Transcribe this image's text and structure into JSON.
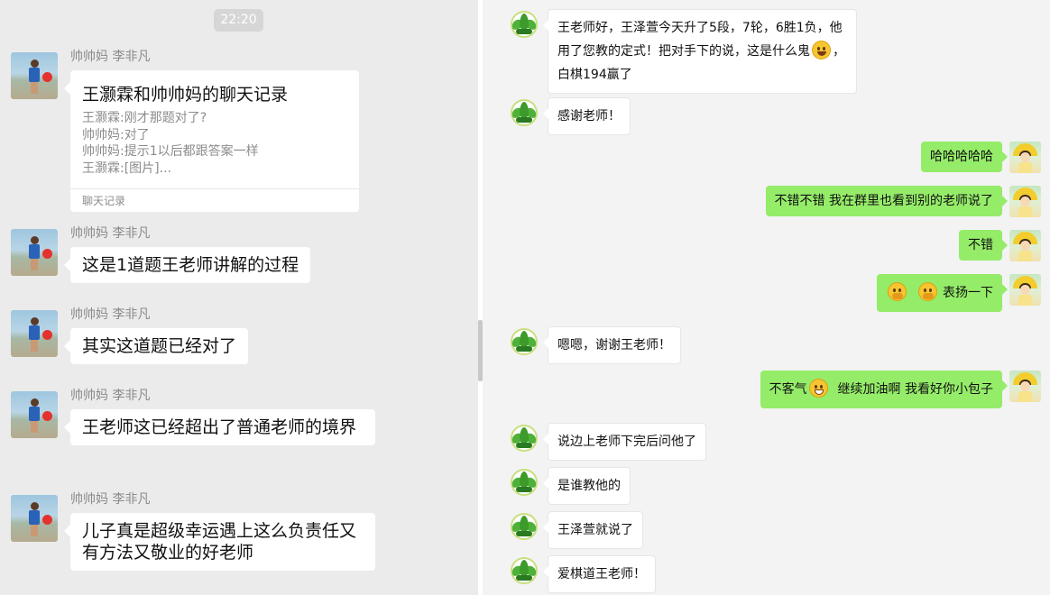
{
  "left": {
    "time": "22:20",
    "record": {
      "sender": "帅帅妈 李非凡",
      "title": "王灏霖和帅帅妈的聊天记录",
      "lines": [
        "王灏霖:刚才那题对了?",
        "帅帅妈:对了",
        "帅帅妈:提示1以后都跟答案一样",
        "王灏霖:[图片]..."
      ],
      "footer": "聊天记录"
    },
    "messages": [
      {
        "sender": "帅帅妈 李非凡",
        "text": "这是1道题王老师讲解的过程"
      },
      {
        "sender": "帅帅妈 李非凡",
        "text": "其实这道题已经对了"
      },
      {
        "sender": "帅帅妈 李非凡",
        "text": "王老师这已经超出了普通老师的境界"
      },
      {
        "sender": "帅帅妈 李非凡",
        "text": "儿子真是超级幸运遇上这么负责任又有方法又敬业的好老师"
      }
    ]
  },
  "right": {
    "msg1": {
      "a": "王老师好，王泽萱今天升了5段，7轮，6胜1负，他用了您教的定式！把对手下的说，这是什么鬼",
      "b": "，白棋194赢了",
      "emoji": "smile-emoji"
    },
    "msg2": "感谢老师！",
    "msg3": "哈哈哈哈哈",
    "msg4": "不错不错 我在群里也看到别的老师说了",
    "msg5": "不错",
    "msg6": {
      "text": "表扬一下",
      "emoji": "cover-mouth-emoji"
    },
    "msg7": "嗯嗯，谢谢王老师！",
    "msg8": {
      "a": "不客气",
      "b": "继续加油啊 我看好你小包子",
      "emoji": "grin-emoji"
    },
    "msg9": "说边上老师下完后问他了",
    "msg10": "是谁教他的",
    "msg11": "王泽萱就说了",
    "msg12": "爱棋道王老师！"
  }
}
